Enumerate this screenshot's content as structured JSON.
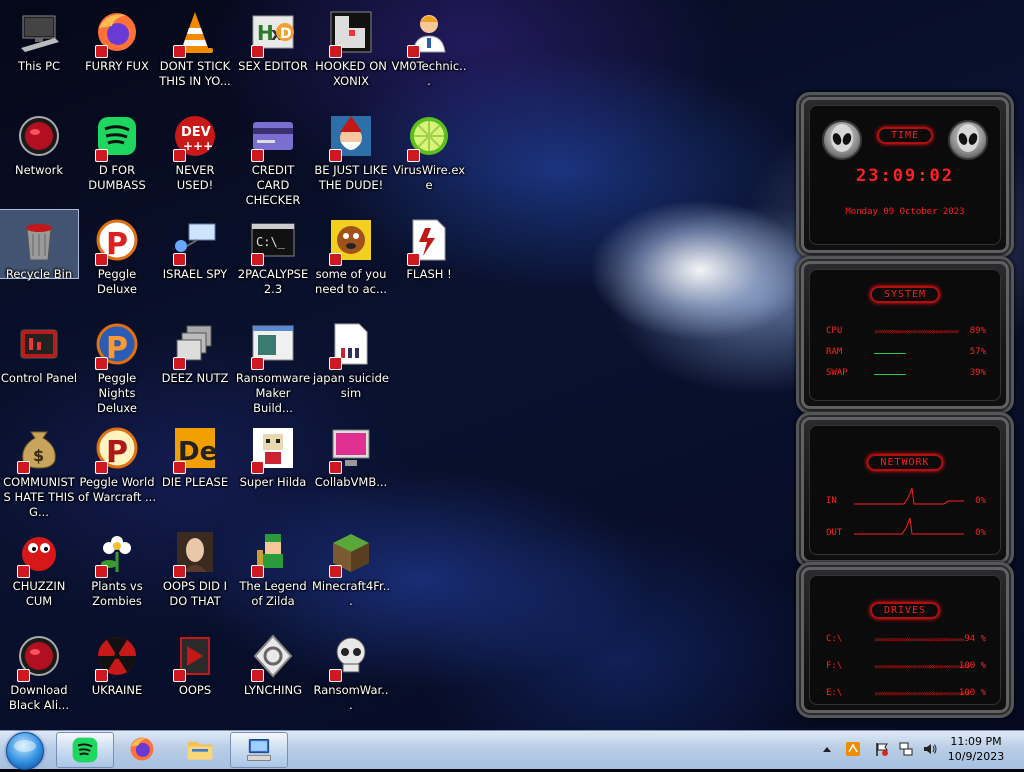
{
  "desktop": {
    "icons": [
      {
        "label": "This PC",
        "icon": "this-pc-icon"
      },
      {
        "label": "FURRY FUX",
        "icon": "firefox-icon"
      },
      {
        "label": "DONT STICK THIS IN YO...",
        "icon": "vlc-cone-icon"
      },
      {
        "label": "SEX EDITOR",
        "icon": "hxd-editor-icon"
      },
      {
        "label": "HOOKED ON XONIX",
        "icon": "xonix-game-icon"
      },
      {
        "label": "VM0Technic...",
        "icon": "technician-person-icon"
      },
      {
        "label": "Network",
        "icon": "alienware-orb-icon"
      },
      {
        "label": "D FOR DUMBASS",
        "icon": "spotify-green-icon"
      },
      {
        "label": "NEVER USED!",
        "icon": "dev-cpp-icon"
      },
      {
        "label": "CREDIT CARD CHECKER",
        "icon": "credit-card-icon"
      },
      {
        "label": "BE JUST LIKE THE DUDE!",
        "icon": "gnome-santa-icon"
      },
      {
        "label": "VirusWire.exe",
        "icon": "lime-slice-icon"
      },
      {
        "label": "Recycle Bin",
        "icon": "recycle-bin-icon"
      },
      {
        "label": "Peggle Deluxe",
        "icon": "peggle-p-icon"
      },
      {
        "label": "ISRAEL SPY",
        "icon": "network-computer-icon"
      },
      {
        "label": "2PACALYPSE 2.3",
        "icon": "terminal-cmd-icon"
      },
      {
        "label": "some of you need to ac...",
        "icon": "dog-cartoon-icon"
      },
      {
        "label": "FLASH !",
        "icon": "flash-doc-icon"
      },
      {
        "label": "Control Panel",
        "icon": "control-panel-icon"
      },
      {
        "label": "Peggle Nights Deluxe",
        "icon": "peggle-nights-icon"
      },
      {
        "label": "DEEZ NUTZ",
        "icon": "stacked-windows-icon"
      },
      {
        "label": "Ransomware Maker Build...",
        "icon": "app-window-icon"
      },
      {
        "label": "japan suicide sim",
        "icon": "document-icon"
      },
      {
        "label": "COMMUNISTS HATE THIS G...",
        "icon": "money-bag-icon"
      },
      {
        "label": "Peggle World of Warcraft ...",
        "icon": "peggle-wow-icon"
      },
      {
        "label": "DIE PLEASE",
        "icon": "de-logo-icon"
      },
      {
        "label": "Super Hilda",
        "icon": "pixel-character-icon"
      },
      {
        "label": "CollabVMB...",
        "icon": "collab-monitor-icon"
      },
      {
        "label": "CHUZZIN CUM",
        "icon": "chuzzle-red-icon"
      },
      {
        "label": "Plants vs Zombies",
        "icon": "flower-icon"
      },
      {
        "label": "OOPS DID I DO THAT",
        "icon": "portrait-lady-icon"
      },
      {
        "label": "The Legend of Zilda",
        "icon": "pixel-hero-icon"
      },
      {
        "label": "Minecraft4Fr...",
        "icon": "grass-block-icon"
      },
      {
        "label": "Download Black Ali...",
        "icon": "alienware-orb-icon"
      },
      {
        "label": "UKRAINE",
        "icon": "radiation-icon"
      },
      {
        "label": "OOPS",
        "icon": "red-app-icon"
      },
      {
        "label": "LYNCHING",
        "icon": "knot-emblem-icon"
      },
      {
        "label": "RansomWar...",
        "icon": "skull-icon"
      }
    ]
  },
  "widget": {
    "time": {
      "title": "TIME",
      "clock": "23:09:02",
      "date": "Monday 09 October 2023"
    },
    "system": {
      "title": "SYSTEM",
      "rows": [
        {
          "name": "CPU",
          "value": "89%",
          "fill": 0.89
        },
        {
          "name": "RAM",
          "value": "57%",
          "fill": 0.57
        },
        {
          "name": "SWAP",
          "value": "39%",
          "fill": 0.39
        }
      ]
    },
    "network": {
      "title": "NETWORK",
      "rows": [
        {
          "name": "IN",
          "value": "0%"
        },
        {
          "name": "OUT",
          "value": "0%"
        }
      ]
    },
    "drives": {
      "title": "DRIVES",
      "rows": [
        {
          "name": "C:\\",
          "value": "94 %",
          "fill": 0.94
        },
        {
          "name": "F:\\",
          "value": "100 %",
          "fill": 1.0
        },
        {
          "name": "E:\\",
          "value": "100 %",
          "fill": 1.0
        }
      ]
    },
    "accent": "#ff1d1d"
  },
  "taskbar": {
    "start": "start-orb-icon",
    "pinned": [
      {
        "name": "spotify-taskbar-button",
        "icon": "spotify-green-icon"
      },
      {
        "name": "firefox-taskbar-button",
        "icon": "firefox-icon"
      },
      {
        "name": "file-explorer-taskbar-button",
        "icon": "folder-icon"
      },
      {
        "name": "vm-taskbar-button",
        "icon": "computer-keyboard-icon"
      }
    ],
    "tray": [
      "show-hidden-icons-arrow",
      "app-tray-icon",
      "action-center-flag-icon",
      "network-tray-icon",
      "volume-icon"
    ],
    "clock": {
      "time": "11:09 PM",
      "date": "10/9/2023"
    }
  }
}
